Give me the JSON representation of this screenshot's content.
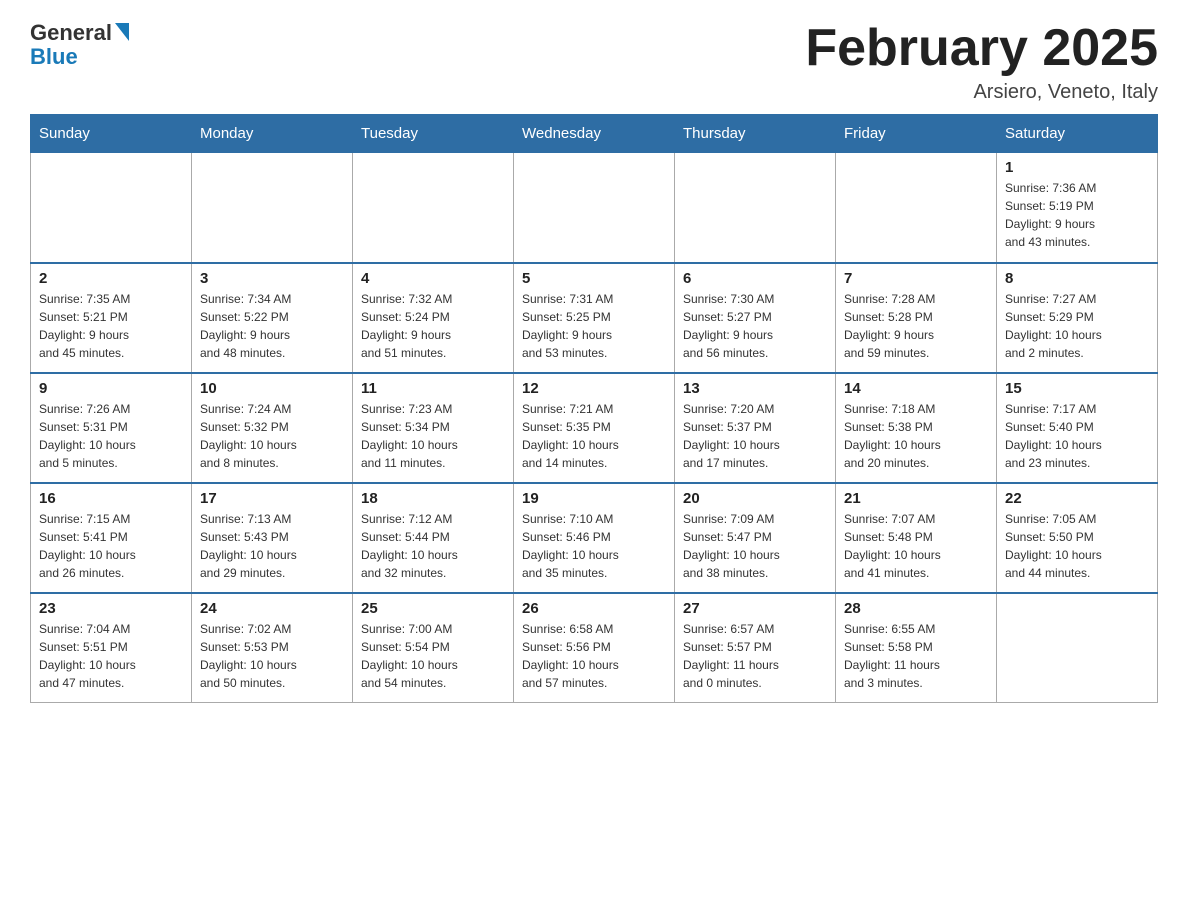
{
  "header": {
    "logo_general": "General",
    "logo_blue": "Blue",
    "month_title": "February 2025",
    "location": "Arsiero, Veneto, Italy"
  },
  "days_of_week": [
    "Sunday",
    "Monday",
    "Tuesday",
    "Wednesday",
    "Thursday",
    "Friday",
    "Saturday"
  ],
  "weeks": [
    {
      "days": [
        {
          "number": "",
          "info": "",
          "empty": true
        },
        {
          "number": "",
          "info": "",
          "empty": true
        },
        {
          "number": "",
          "info": "",
          "empty": true
        },
        {
          "number": "",
          "info": "",
          "empty": true
        },
        {
          "number": "",
          "info": "",
          "empty": true
        },
        {
          "number": "",
          "info": "",
          "empty": true
        },
        {
          "number": "1",
          "info": "Sunrise: 7:36 AM\nSunset: 5:19 PM\nDaylight: 9 hours\nand 43 minutes.",
          "empty": false
        }
      ]
    },
    {
      "days": [
        {
          "number": "2",
          "info": "Sunrise: 7:35 AM\nSunset: 5:21 PM\nDaylight: 9 hours\nand 45 minutes.",
          "empty": false
        },
        {
          "number": "3",
          "info": "Sunrise: 7:34 AM\nSunset: 5:22 PM\nDaylight: 9 hours\nand 48 minutes.",
          "empty": false
        },
        {
          "number": "4",
          "info": "Sunrise: 7:32 AM\nSunset: 5:24 PM\nDaylight: 9 hours\nand 51 minutes.",
          "empty": false
        },
        {
          "number": "5",
          "info": "Sunrise: 7:31 AM\nSunset: 5:25 PM\nDaylight: 9 hours\nand 53 minutes.",
          "empty": false
        },
        {
          "number": "6",
          "info": "Sunrise: 7:30 AM\nSunset: 5:27 PM\nDaylight: 9 hours\nand 56 minutes.",
          "empty": false
        },
        {
          "number": "7",
          "info": "Sunrise: 7:28 AM\nSunset: 5:28 PM\nDaylight: 9 hours\nand 59 minutes.",
          "empty": false
        },
        {
          "number": "8",
          "info": "Sunrise: 7:27 AM\nSunset: 5:29 PM\nDaylight: 10 hours\nand 2 minutes.",
          "empty": false
        }
      ]
    },
    {
      "days": [
        {
          "number": "9",
          "info": "Sunrise: 7:26 AM\nSunset: 5:31 PM\nDaylight: 10 hours\nand 5 minutes.",
          "empty": false
        },
        {
          "number": "10",
          "info": "Sunrise: 7:24 AM\nSunset: 5:32 PM\nDaylight: 10 hours\nand 8 minutes.",
          "empty": false
        },
        {
          "number": "11",
          "info": "Sunrise: 7:23 AM\nSunset: 5:34 PM\nDaylight: 10 hours\nand 11 minutes.",
          "empty": false
        },
        {
          "number": "12",
          "info": "Sunrise: 7:21 AM\nSunset: 5:35 PM\nDaylight: 10 hours\nand 14 minutes.",
          "empty": false
        },
        {
          "number": "13",
          "info": "Sunrise: 7:20 AM\nSunset: 5:37 PM\nDaylight: 10 hours\nand 17 minutes.",
          "empty": false
        },
        {
          "number": "14",
          "info": "Sunrise: 7:18 AM\nSunset: 5:38 PM\nDaylight: 10 hours\nand 20 minutes.",
          "empty": false
        },
        {
          "number": "15",
          "info": "Sunrise: 7:17 AM\nSunset: 5:40 PM\nDaylight: 10 hours\nand 23 minutes.",
          "empty": false
        }
      ]
    },
    {
      "days": [
        {
          "number": "16",
          "info": "Sunrise: 7:15 AM\nSunset: 5:41 PM\nDaylight: 10 hours\nand 26 minutes.",
          "empty": false
        },
        {
          "number": "17",
          "info": "Sunrise: 7:13 AM\nSunset: 5:43 PM\nDaylight: 10 hours\nand 29 minutes.",
          "empty": false
        },
        {
          "number": "18",
          "info": "Sunrise: 7:12 AM\nSunset: 5:44 PM\nDaylight: 10 hours\nand 32 minutes.",
          "empty": false
        },
        {
          "number": "19",
          "info": "Sunrise: 7:10 AM\nSunset: 5:46 PM\nDaylight: 10 hours\nand 35 minutes.",
          "empty": false
        },
        {
          "number": "20",
          "info": "Sunrise: 7:09 AM\nSunset: 5:47 PM\nDaylight: 10 hours\nand 38 minutes.",
          "empty": false
        },
        {
          "number": "21",
          "info": "Sunrise: 7:07 AM\nSunset: 5:48 PM\nDaylight: 10 hours\nand 41 minutes.",
          "empty": false
        },
        {
          "number": "22",
          "info": "Sunrise: 7:05 AM\nSunset: 5:50 PM\nDaylight: 10 hours\nand 44 minutes.",
          "empty": false
        }
      ]
    },
    {
      "days": [
        {
          "number": "23",
          "info": "Sunrise: 7:04 AM\nSunset: 5:51 PM\nDaylight: 10 hours\nand 47 minutes.",
          "empty": false
        },
        {
          "number": "24",
          "info": "Sunrise: 7:02 AM\nSunset: 5:53 PM\nDaylight: 10 hours\nand 50 minutes.",
          "empty": false
        },
        {
          "number": "25",
          "info": "Sunrise: 7:00 AM\nSunset: 5:54 PM\nDaylight: 10 hours\nand 54 minutes.",
          "empty": false
        },
        {
          "number": "26",
          "info": "Sunrise: 6:58 AM\nSunset: 5:56 PM\nDaylight: 10 hours\nand 57 minutes.",
          "empty": false
        },
        {
          "number": "27",
          "info": "Sunrise: 6:57 AM\nSunset: 5:57 PM\nDaylight: 11 hours\nand 0 minutes.",
          "empty": false
        },
        {
          "number": "28",
          "info": "Sunrise: 6:55 AM\nSunset: 5:58 PM\nDaylight: 11 hours\nand 3 minutes.",
          "empty": false
        },
        {
          "number": "",
          "info": "",
          "empty": true
        }
      ]
    }
  ]
}
